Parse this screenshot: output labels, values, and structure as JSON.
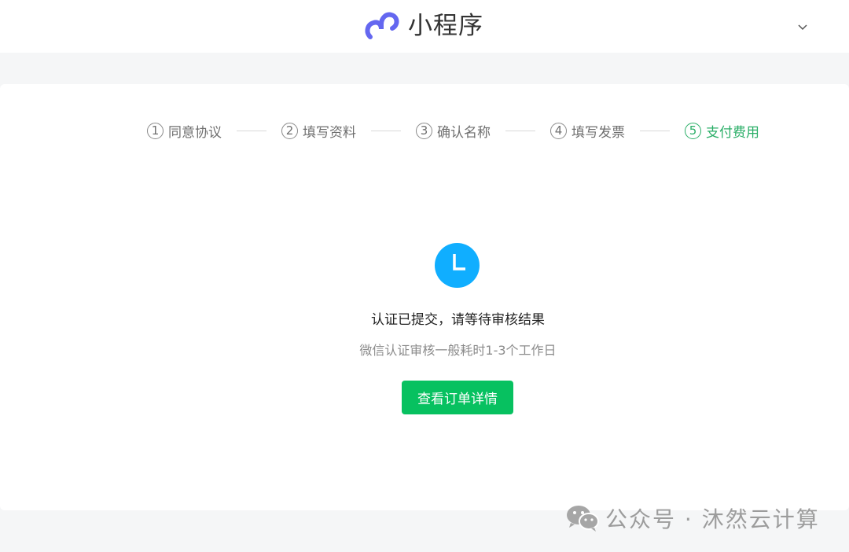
{
  "header": {
    "app_name": "小程序",
    "logo_icon": "mini-program-logo-icon",
    "logo_color": "#6467f0",
    "menu_icon": "chevron-down-icon"
  },
  "steps": [
    {
      "number": "1",
      "label": "同意协议",
      "active": false
    },
    {
      "number": "2",
      "label": "填写资料",
      "active": false
    },
    {
      "number": "3",
      "label": "确认名称",
      "active": false
    },
    {
      "number": "4",
      "label": "填写发票",
      "active": false
    },
    {
      "number": "5",
      "label": "支付费用",
      "active": true
    }
  ],
  "result": {
    "icon": "clock-icon",
    "icon_color": "#10aeff",
    "title": "认证已提交，请等待审核结果",
    "description": "微信认证审核一般耗时1-3个工作日",
    "button_label": "查看订单详情",
    "button_color": "#07c160"
  },
  "watermark": {
    "icon": "wechat-icon",
    "text": "公众号 · 沐然云计算"
  },
  "colors": {
    "active_step": "#2aae67",
    "background": "#f5f6f7"
  }
}
